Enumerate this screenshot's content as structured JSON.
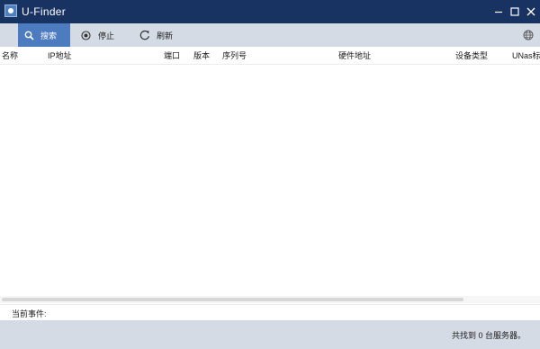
{
  "window": {
    "title": "U-Finder",
    "controls": {
      "minimize_icon": "minimize-icon",
      "maximize_icon": "maximize-icon",
      "close_icon": "close-icon"
    }
  },
  "toolbar": {
    "search_label": "搜索",
    "stop_label": "停止",
    "refresh_label": "刷新",
    "language_icon": "globe-icon"
  },
  "table": {
    "columns": [
      "名称",
      "IP地址",
      "端口",
      "版本",
      "序列号",
      "硬件地址",
      "设备类型",
      "UNas标示"
    ],
    "rows": []
  },
  "event": {
    "label": "当前事件:"
  },
  "status": {
    "text": "共找到 0 台服务器。"
  },
  "colors": {
    "titlebar": "#183261",
    "toolbar": "#d5dbe5",
    "active_button": "#4d7bc0"
  }
}
